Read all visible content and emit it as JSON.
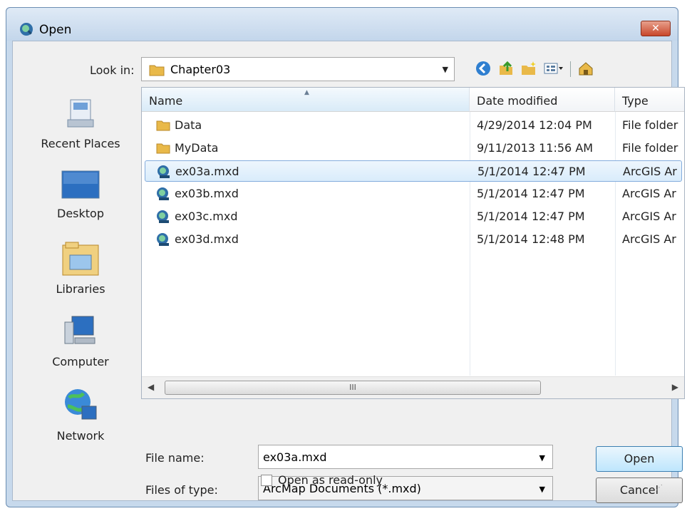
{
  "window": {
    "title": "Open",
    "close_label": "✕"
  },
  "look_in": {
    "label": "Look in:",
    "value": "Chapter03"
  },
  "places": [
    {
      "label": "Recent Places",
      "icon": "recent-places-icon"
    },
    {
      "label": "Desktop",
      "icon": "desktop-icon"
    },
    {
      "label": "Libraries",
      "icon": "libraries-icon"
    },
    {
      "label": "Computer",
      "icon": "computer-icon"
    },
    {
      "label": "Network",
      "icon": "network-icon"
    }
  ],
  "columns": {
    "name": "Name",
    "date": "Date modified",
    "type": "Type"
  },
  "files": [
    {
      "name": "Data",
      "date": "4/29/2014 12:04 PM",
      "type": "File folder",
      "icon": "folder-icon",
      "selected": false
    },
    {
      "name": "MyData",
      "date": "9/11/2013 11:56 AM",
      "type": "File folder",
      "icon": "folder-icon",
      "selected": false
    },
    {
      "name": "ex03a.mxd",
      "date": "5/1/2014 12:47 PM",
      "type": "ArcGIS Ar",
      "icon": "mxd-icon",
      "selected": true
    },
    {
      "name": "ex03b.mxd",
      "date": "5/1/2014 12:47 PM",
      "type": "ArcGIS Ar",
      "icon": "mxd-icon",
      "selected": false
    },
    {
      "name": "ex03c.mxd",
      "date": "5/1/2014 12:47 PM",
      "type": "ArcGIS Ar",
      "icon": "mxd-icon",
      "selected": false
    },
    {
      "name": "ex03d.mxd",
      "date": "5/1/2014 12:48 PM",
      "type": "ArcGIS Ar",
      "icon": "mxd-icon",
      "selected": false
    }
  ],
  "scrollbar": {
    "thumb_grip": "III"
  },
  "file_name": {
    "label": "File name:",
    "value": "ex03a.mxd"
  },
  "file_type": {
    "label": "Files of type:",
    "value": "ArcMap Documents (*.mxd)"
  },
  "read_only": {
    "label": "Open as read-only",
    "checked": false
  },
  "buttons": {
    "open": "Open",
    "cancel": "Cancel"
  },
  "colors": {
    "accent": "#3c7fb1",
    "selection": "#d9ecfb",
    "title_bar": "#c7d9ec"
  }
}
